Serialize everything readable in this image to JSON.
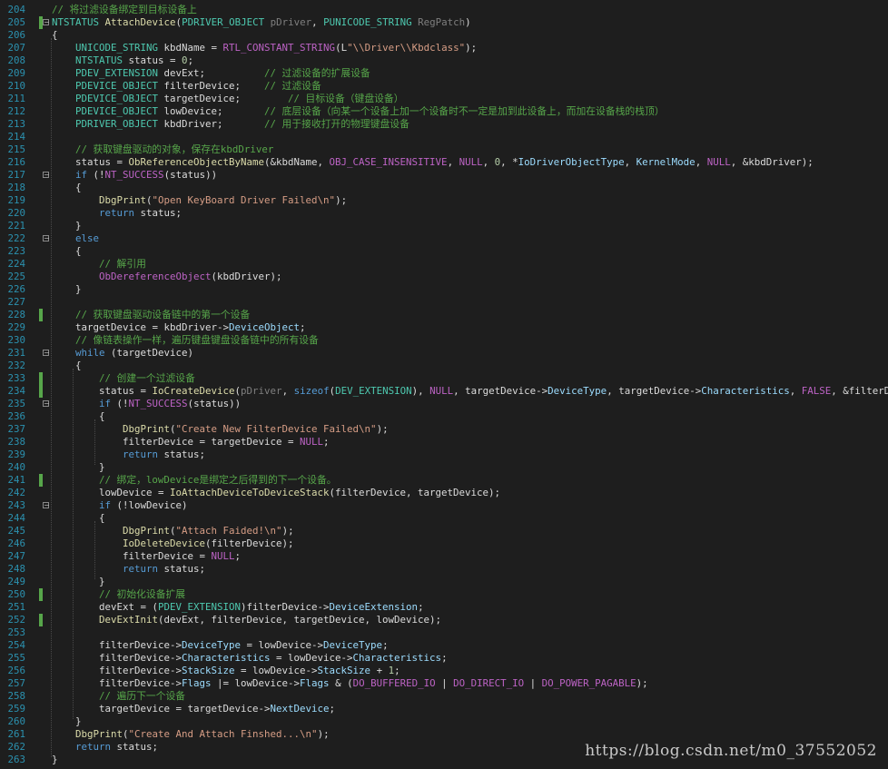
{
  "palette": {
    "d": "#dcdcdc",
    "k": "#569cd6",
    "t": "#4ec9b0",
    "f": "#dcdcaa",
    "m": "#bd63c5",
    "s": "#d69d85",
    "c": "#57a64a",
    "n": "#b5cea8",
    "v": "#9cdcfe",
    "p": "#7f7f7f"
  },
  "lines": [
    {
      "n": "204",
      "tok": [
        [
          "c",
          "// 将过滤设备绑定到目标设备上"
        ]
      ]
    },
    {
      "n": "205",
      "mark": true,
      "fold": "−",
      "tok": [
        [
          "t",
          "NTSTATUS"
        ],
        [
          "d",
          " "
        ],
        [
          "f",
          "AttachDevice"
        ],
        [
          "d",
          "("
        ],
        [
          "t",
          "PDRIVER_OBJECT"
        ],
        [
          "d",
          " "
        ],
        [
          "p",
          "pDriver"
        ],
        [
          "d",
          ", "
        ],
        [
          "t",
          "PUNICODE_STRING"
        ],
        [
          "d",
          " "
        ],
        [
          "p",
          "RegPatch"
        ],
        [
          "d",
          ")"
        ]
      ]
    },
    {
      "n": "206",
      "tok": [
        [
          "d",
          "{"
        ]
      ]
    },
    {
      "n": "207",
      "tok": [
        [
          "d",
          "    "
        ],
        [
          "t",
          "UNICODE_STRING"
        ],
        [
          "d",
          " kbdName = "
        ],
        [
          "m",
          "RTL_CONSTANT_STRING"
        ],
        [
          "d",
          "(L"
        ],
        [
          "s",
          "\"\\\\Driver\\\\Kbdclass\""
        ],
        [
          "d",
          ");"
        ]
      ]
    },
    {
      "n": "208",
      "tok": [
        [
          "d",
          "    "
        ],
        [
          "t",
          "NTSTATUS"
        ],
        [
          "d",
          " status = "
        ],
        [
          "n",
          "0"
        ],
        [
          "d",
          ";"
        ]
      ]
    },
    {
      "n": "209",
      "tok": [
        [
          "d",
          "    "
        ],
        [
          "t",
          "PDEV_EXTENSION"
        ],
        [
          "d",
          " devExt;          "
        ],
        [
          "c",
          "// 过滤设备的扩展设备"
        ]
      ]
    },
    {
      "n": "210",
      "tok": [
        [
          "d",
          "    "
        ],
        [
          "t",
          "PDEVICE_OBJECT"
        ],
        [
          "d",
          " filterDevice;    "
        ],
        [
          "c",
          "// 过滤设备"
        ]
      ]
    },
    {
      "n": "211",
      "tok": [
        [
          "d",
          "    "
        ],
        [
          "t",
          "PDEVICE_OBJECT"
        ],
        [
          "d",
          " targetDevice;        "
        ],
        [
          "c",
          "// 目标设备（键盘设备）"
        ]
      ]
    },
    {
      "n": "212",
      "tok": [
        [
          "d",
          "    "
        ],
        [
          "t",
          "PDEVICE_OBJECT"
        ],
        [
          "d",
          " lowDevice;       "
        ],
        [
          "c",
          "// 底层设备（向某一个设备上加一个设备时不一定是加到此设备上，而加在设备栈的栈顶）"
        ]
      ]
    },
    {
      "n": "213",
      "tok": [
        [
          "d",
          "    "
        ],
        [
          "t",
          "PDRIVER_OBJECT"
        ],
        [
          "d",
          " kbdDriver;       "
        ],
        [
          "c",
          "// 用于接收打开的物理键盘设备"
        ]
      ]
    },
    {
      "n": "214",
      "tok": []
    },
    {
      "n": "215",
      "tok": [
        [
          "d",
          "    "
        ],
        [
          "c",
          "// 获取键盘驱动的对象，保存在kbdDriver"
        ]
      ]
    },
    {
      "n": "216",
      "tok": [
        [
          "d",
          "    status = "
        ],
        [
          "f",
          "ObReferenceObjectByName"
        ],
        [
          "d",
          "(&kbdName, "
        ],
        [
          "m",
          "OBJ_CASE_INSENSITIVE"
        ],
        [
          "d",
          ", "
        ],
        [
          "m",
          "NULL"
        ],
        [
          "d",
          ", "
        ],
        [
          "n",
          "0"
        ],
        [
          "d",
          ", *"
        ],
        [
          "v",
          "IoDriverObjectType"
        ],
        [
          "d",
          ", "
        ],
        [
          "v",
          "KernelMode"
        ],
        [
          "d",
          ", "
        ],
        [
          "m",
          "NULL"
        ],
        [
          "d",
          ", &kbdDriver);"
        ]
      ]
    },
    {
      "n": "217",
      "fold": "−",
      "tok": [
        [
          "d",
          "    "
        ],
        [
          "k",
          "if"
        ],
        [
          "d",
          " (!"
        ],
        [
          "m",
          "NT_SUCCESS"
        ],
        [
          "d",
          "(status))"
        ]
      ]
    },
    {
      "n": "218",
      "tok": [
        [
          "d",
          "    {"
        ]
      ]
    },
    {
      "n": "219",
      "tok": [
        [
          "d",
          "        "
        ],
        [
          "f",
          "DbgPrint"
        ],
        [
          "d",
          "("
        ],
        [
          "s",
          "\"Open KeyBoard Driver Failed\\n\""
        ],
        [
          "d",
          ");"
        ]
      ]
    },
    {
      "n": "220",
      "tok": [
        [
          "d",
          "        "
        ],
        [
          "k",
          "return"
        ],
        [
          "d",
          " status;"
        ]
      ]
    },
    {
      "n": "221",
      "tok": [
        [
          "d",
          "    }"
        ]
      ]
    },
    {
      "n": "222",
      "fold": "−",
      "tok": [
        [
          "d",
          "    "
        ],
        [
          "k",
          "else"
        ]
      ]
    },
    {
      "n": "223",
      "tok": [
        [
          "d",
          "    {"
        ]
      ]
    },
    {
      "n": "224",
      "tok": [
        [
          "d",
          "        "
        ],
        [
          "c",
          "// 解引用"
        ]
      ]
    },
    {
      "n": "225",
      "tok": [
        [
          "d",
          "        "
        ],
        [
          "m",
          "ObDereferenceObject"
        ],
        [
          "d",
          "(kbdDriver);"
        ]
      ]
    },
    {
      "n": "226",
      "tok": [
        [
          "d",
          "    }"
        ]
      ]
    },
    {
      "n": "227",
      "tok": []
    },
    {
      "n": "228",
      "mark": true,
      "tok": [
        [
          "d",
          "    "
        ],
        [
          "c",
          "// 获取键盘驱动设备链中的第一个设备"
        ]
      ]
    },
    {
      "n": "229",
      "tok": [
        [
          "d",
          "    targetDevice = kbdDriver->"
        ],
        [
          "v",
          "DeviceObject"
        ],
        [
          "d",
          ";"
        ]
      ]
    },
    {
      "n": "230",
      "tok": [
        [
          "d",
          "    "
        ],
        [
          "c",
          "// 像链表操作一样，遍历键盘键盘设备链中的所有设备"
        ]
      ]
    },
    {
      "n": "231",
      "fold": "−",
      "tok": [
        [
          "d",
          "    "
        ],
        [
          "k",
          "while"
        ],
        [
          "d",
          " (targetDevice)"
        ]
      ]
    },
    {
      "n": "232",
      "tok": [
        [
          "d",
          "    {"
        ]
      ]
    },
    {
      "n": "233",
      "mark": true,
      "tok": [
        [
          "d",
          "        "
        ],
        [
          "c",
          "// 创建一个过滤设备"
        ]
      ]
    },
    {
      "n": "234",
      "mark": true,
      "tok": [
        [
          "d",
          "        status = "
        ],
        [
          "f",
          "IoCreateDevice"
        ],
        [
          "d",
          "("
        ],
        [
          "p",
          "pDriver"
        ],
        [
          "d",
          ", "
        ],
        [
          "k",
          "sizeof"
        ],
        [
          "d",
          "("
        ],
        [
          "t",
          "DEV_EXTENSION"
        ],
        [
          "d",
          "), "
        ],
        [
          "m",
          "NULL"
        ],
        [
          "d",
          ", targetDevice->"
        ],
        [
          "v",
          "DeviceType"
        ],
        [
          "d",
          ", targetDevice->"
        ],
        [
          "v",
          "Characteristics"
        ],
        [
          "d",
          ", "
        ],
        [
          "m",
          "FALSE"
        ],
        [
          "d",
          ", &filterDevice);"
        ]
      ]
    },
    {
      "n": "235",
      "fold": "−",
      "tok": [
        [
          "d",
          "        "
        ],
        [
          "k",
          "if"
        ],
        [
          "d",
          " (!"
        ],
        [
          "m",
          "NT_SUCCESS"
        ],
        [
          "d",
          "(status))"
        ]
      ]
    },
    {
      "n": "236",
      "tok": [
        [
          "d",
          "        {"
        ]
      ]
    },
    {
      "n": "237",
      "tok": [
        [
          "d",
          "            "
        ],
        [
          "f",
          "DbgPrint"
        ],
        [
          "d",
          "("
        ],
        [
          "s",
          "\"Create New FilterDevice Failed\\n\""
        ],
        [
          "d",
          ");"
        ]
      ]
    },
    {
      "n": "238",
      "tok": [
        [
          "d",
          "            filterDevice = targetDevice = "
        ],
        [
          "m",
          "NULL"
        ],
        [
          "d",
          ";"
        ]
      ]
    },
    {
      "n": "239",
      "tok": [
        [
          "d",
          "            "
        ],
        [
          "k",
          "return"
        ],
        [
          "d",
          " status;"
        ]
      ]
    },
    {
      "n": "240",
      "tok": [
        [
          "d",
          "        }"
        ]
      ]
    },
    {
      "n": "241",
      "mark": true,
      "tok": [
        [
          "d",
          "        "
        ],
        [
          "c",
          "// 绑定，lowDevice是绑定之后得到的下一个设备。"
        ]
      ]
    },
    {
      "n": "242",
      "tok": [
        [
          "d",
          "        lowDevice = "
        ],
        [
          "f",
          "IoAttachDeviceToDeviceStack"
        ],
        [
          "d",
          "(filterDevice, targetDevice);"
        ]
      ]
    },
    {
      "n": "243",
      "fold": "−",
      "tok": [
        [
          "d",
          "        "
        ],
        [
          "k",
          "if"
        ],
        [
          "d",
          " (!lowDevice)"
        ]
      ]
    },
    {
      "n": "244",
      "tok": [
        [
          "d",
          "        {"
        ]
      ]
    },
    {
      "n": "245",
      "tok": [
        [
          "d",
          "            "
        ],
        [
          "f",
          "DbgPrint"
        ],
        [
          "d",
          "("
        ],
        [
          "s",
          "\"Attach Faided!\\n\""
        ],
        [
          "d",
          ");"
        ]
      ]
    },
    {
      "n": "246",
      "tok": [
        [
          "d",
          "            "
        ],
        [
          "f",
          "IoDeleteDevice"
        ],
        [
          "d",
          "(filterDevice);"
        ]
      ]
    },
    {
      "n": "247",
      "tok": [
        [
          "d",
          "            filterDevice = "
        ],
        [
          "m",
          "NULL"
        ],
        [
          "d",
          ";"
        ]
      ]
    },
    {
      "n": "248",
      "tok": [
        [
          "d",
          "            "
        ],
        [
          "k",
          "return"
        ],
        [
          "d",
          " status;"
        ]
      ]
    },
    {
      "n": "249",
      "tok": [
        [
          "d",
          "        }"
        ]
      ]
    },
    {
      "n": "250",
      "mark": true,
      "tok": [
        [
          "d",
          "        "
        ],
        [
          "c",
          "// 初始化设备扩展"
        ]
      ]
    },
    {
      "n": "251",
      "tok": [
        [
          "d",
          "        devExt = ("
        ],
        [
          "t",
          "PDEV_EXTENSION"
        ],
        [
          "d",
          ")filterDevice->"
        ],
        [
          "v",
          "DeviceExtension"
        ],
        [
          "d",
          ";"
        ]
      ]
    },
    {
      "n": "252",
      "mark": true,
      "tok": [
        [
          "d",
          "        "
        ],
        [
          "f",
          "DevExtInit"
        ],
        [
          "d",
          "(devExt, filterDevice, targetDevice, lowDevice);"
        ]
      ]
    },
    {
      "n": "253",
      "tok": []
    },
    {
      "n": "254",
      "tok": [
        [
          "d",
          "        filterDevice->"
        ],
        [
          "v",
          "DeviceType"
        ],
        [
          "d",
          " = lowDevice->"
        ],
        [
          "v",
          "DeviceType"
        ],
        [
          "d",
          ";"
        ]
      ]
    },
    {
      "n": "255",
      "tok": [
        [
          "d",
          "        filterDevice->"
        ],
        [
          "v",
          "Characteristics"
        ],
        [
          "d",
          " = lowDevice->"
        ],
        [
          "v",
          "Characteristics"
        ],
        [
          "d",
          ";"
        ]
      ]
    },
    {
      "n": "256",
      "tok": [
        [
          "d",
          "        filterDevice->"
        ],
        [
          "v",
          "StackSize"
        ],
        [
          "d",
          " = lowDevice->"
        ],
        [
          "v",
          "StackSize"
        ],
        [
          "d",
          " + "
        ],
        [
          "n",
          "1"
        ],
        [
          "d",
          ";"
        ]
      ]
    },
    {
      "n": "257",
      "tok": [
        [
          "d",
          "        filterDevice->"
        ],
        [
          "v",
          "Flags"
        ],
        [
          "d",
          " |= lowDevice->"
        ],
        [
          "v",
          "Flags"
        ],
        [
          "d",
          " & ("
        ],
        [
          "m",
          "DO_BUFFERED_IO"
        ],
        [
          "d",
          " | "
        ],
        [
          "m",
          "DO_DIRECT_IO"
        ],
        [
          "d",
          " | "
        ],
        [
          "m",
          "DO_POWER_PAGABLE"
        ],
        [
          "d",
          ");"
        ]
      ]
    },
    {
      "n": "258",
      "tok": [
        [
          "d",
          "        "
        ],
        [
          "c",
          "// 遍历下一个设备"
        ]
      ]
    },
    {
      "n": "259",
      "tok": [
        [
          "d",
          "        targetDevice = targetDevice->"
        ],
        [
          "v",
          "NextDevice"
        ],
        [
          "d",
          ";"
        ]
      ]
    },
    {
      "n": "260",
      "tok": [
        [
          "d",
          "    }"
        ]
      ]
    },
    {
      "n": "261",
      "tok": [
        [
          "d",
          "    "
        ],
        [
          "f",
          "DbgPrint"
        ],
        [
          "d",
          "("
        ],
        [
          "s",
          "\"Create And Attach Finshed...\\n\""
        ],
        [
          "d",
          ");"
        ]
      ]
    },
    {
      "n": "262",
      "tok": [
        [
          "d",
          "    "
        ],
        [
          "k",
          "return"
        ],
        [
          "d",
          " status;"
        ]
      ]
    },
    {
      "n": "263",
      "tok": [
        [
          "d",
          "}"
        ]
      ]
    }
  ],
  "watermark": "https://blog.csdn.net/m0_37552052"
}
